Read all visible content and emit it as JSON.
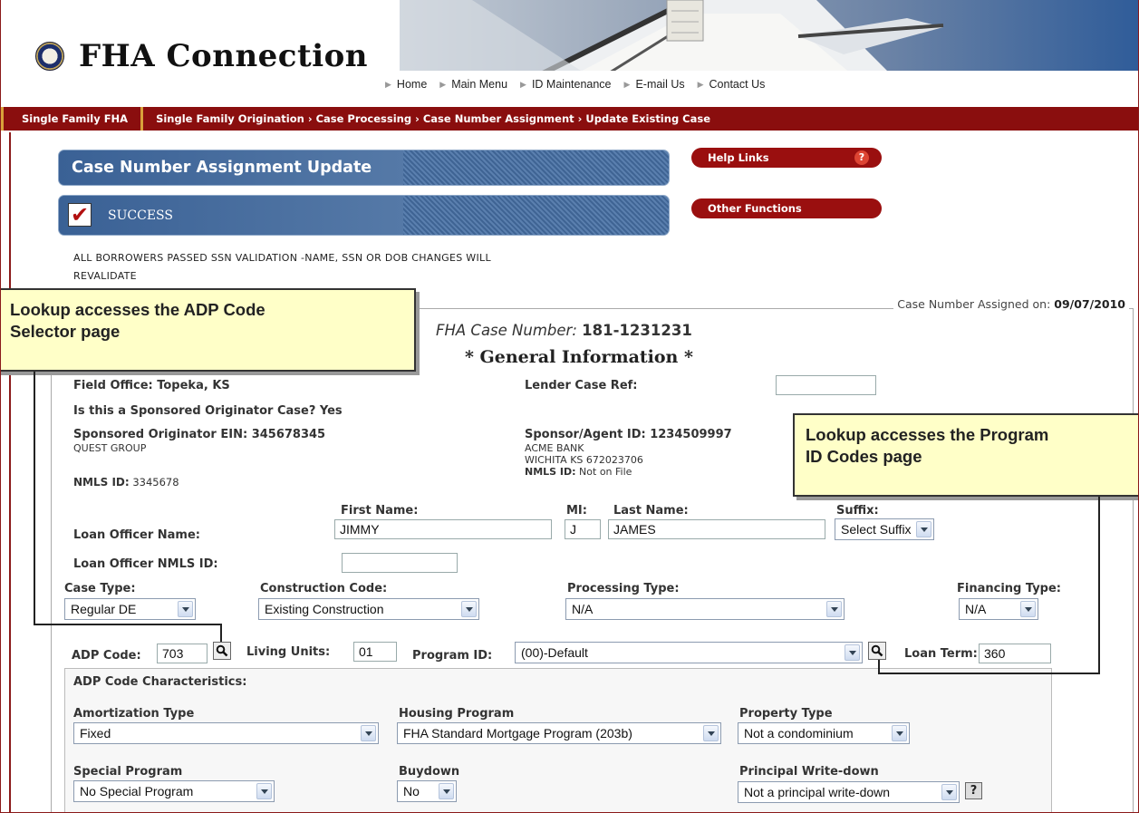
{
  "app": {
    "title": "FHA Connection"
  },
  "topnav": [
    {
      "label": "Home"
    },
    {
      "label": "Main Menu"
    },
    {
      "label": "ID Maintenance"
    },
    {
      "label": "E-mail Us"
    },
    {
      "label": "Contact Us"
    }
  ],
  "breadcrumb": {
    "root": "Single Family FHA",
    "trail": [
      "Single Family Origination",
      "Case Processing",
      "Case Number Assignment",
      "Update Existing Case"
    ],
    "separator": "›"
  },
  "header": {
    "title": "Case Number Assignment Update"
  },
  "status": {
    "label": "SUCCESS",
    "line1": "ALL BORROWERS PASSED SSN VALIDATION -NAME, SSN OR DOB CHANGES WILL",
    "line2": "REVALIDATE"
  },
  "side_links": {
    "help": "Help Links",
    "help_icon": "?",
    "other": "Other Functions"
  },
  "case": {
    "assigned_label": "Case Number Assigned on:",
    "assigned_date": "09/07/2010",
    "number_label": "FHA Case Number:",
    "number": "181-1231231",
    "section_title": "* General Information *"
  },
  "general": {
    "field_office": "Field Office: Topeka, KS",
    "lender_ref_label": "Lender Case Ref:",
    "lender_ref_value": "",
    "sponsored_q": "Is this a Sponsored Originator Case? Yes",
    "originator_ein": "Sponsored Originator EIN: 345678345",
    "originator_name": "QUEST GROUP",
    "originator_nmls_label": "NMLS ID:",
    "originator_nmls": "3345678",
    "sponsor_id": "Sponsor/Agent ID: 1234509997",
    "sponsor_name": "ACME BANK",
    "sponsor_addr": "WICHITA KS 672023706",
    "sponsor_nmls_label": "NMLS ID:",
    "sponsor_nmls": "Not on File"
  },
  "loan_officer": {
    "name_label": "Loan Officer Name:",
    "first_label": "First Name:",
    "first": "JIMMY",
    "mi_label": "MI:",
    "mi": "J",
    "last_label": "Last Name:",
    "last": "JAMES",
    "suffix_label": "Suffix:",
    "suffix": "Select Suffix",
    "nmls_label": "Loan Officer NMLS ID:",
    "nmls": ""
  },
  "case_details": {
    "case_type_label": "Case Type:",
    "case_type": "Regular DE",
    "construction_label": "Construction Code:",
    "construction": "Existing Construction",
    "processing_label": "Processing Type:",
    "processing": "N/A",
    "financing_label": "Financing Type:",
    "financing": "N/A",
    "adp_label": "ADP Code:",
    "adp": "703",
    "living_label": "Living Units:",
    "living": "01",
    "program_label": "Program ID:",
    "program": "(00)-Default",
    "term_label": "Loan Term:",
    "term": "360"
  },
  "adp_characteristics": {
    "title": "ADP Code Characteristics:",
    "amortization_label": "Amortization Type",
    "amortization": "Fixed",
    "housing_label": "Housing Program",
    "housing": "FHA Standard Mortgage Program (203b)",
    "property_label": "Property Type",
    "property": "Not a condominium",
    "special_label": "Special Program",
    "special": "No Special Program",
    "buydown_label": "Buydown",
    "buydown": "No",
    "writedown_label": "Principal Write-down",
    "writedown": "Not a principal write-down",
    "help_icon": "?"
  },
  "callouts": {
    "adp_line1": "Lookup accesses the ADP Code",
    "adp_line2": "Selector page",
    "program_line1": "Lookup accesses the Program",
    "program_line2": "ID Codes page"
  }
}
